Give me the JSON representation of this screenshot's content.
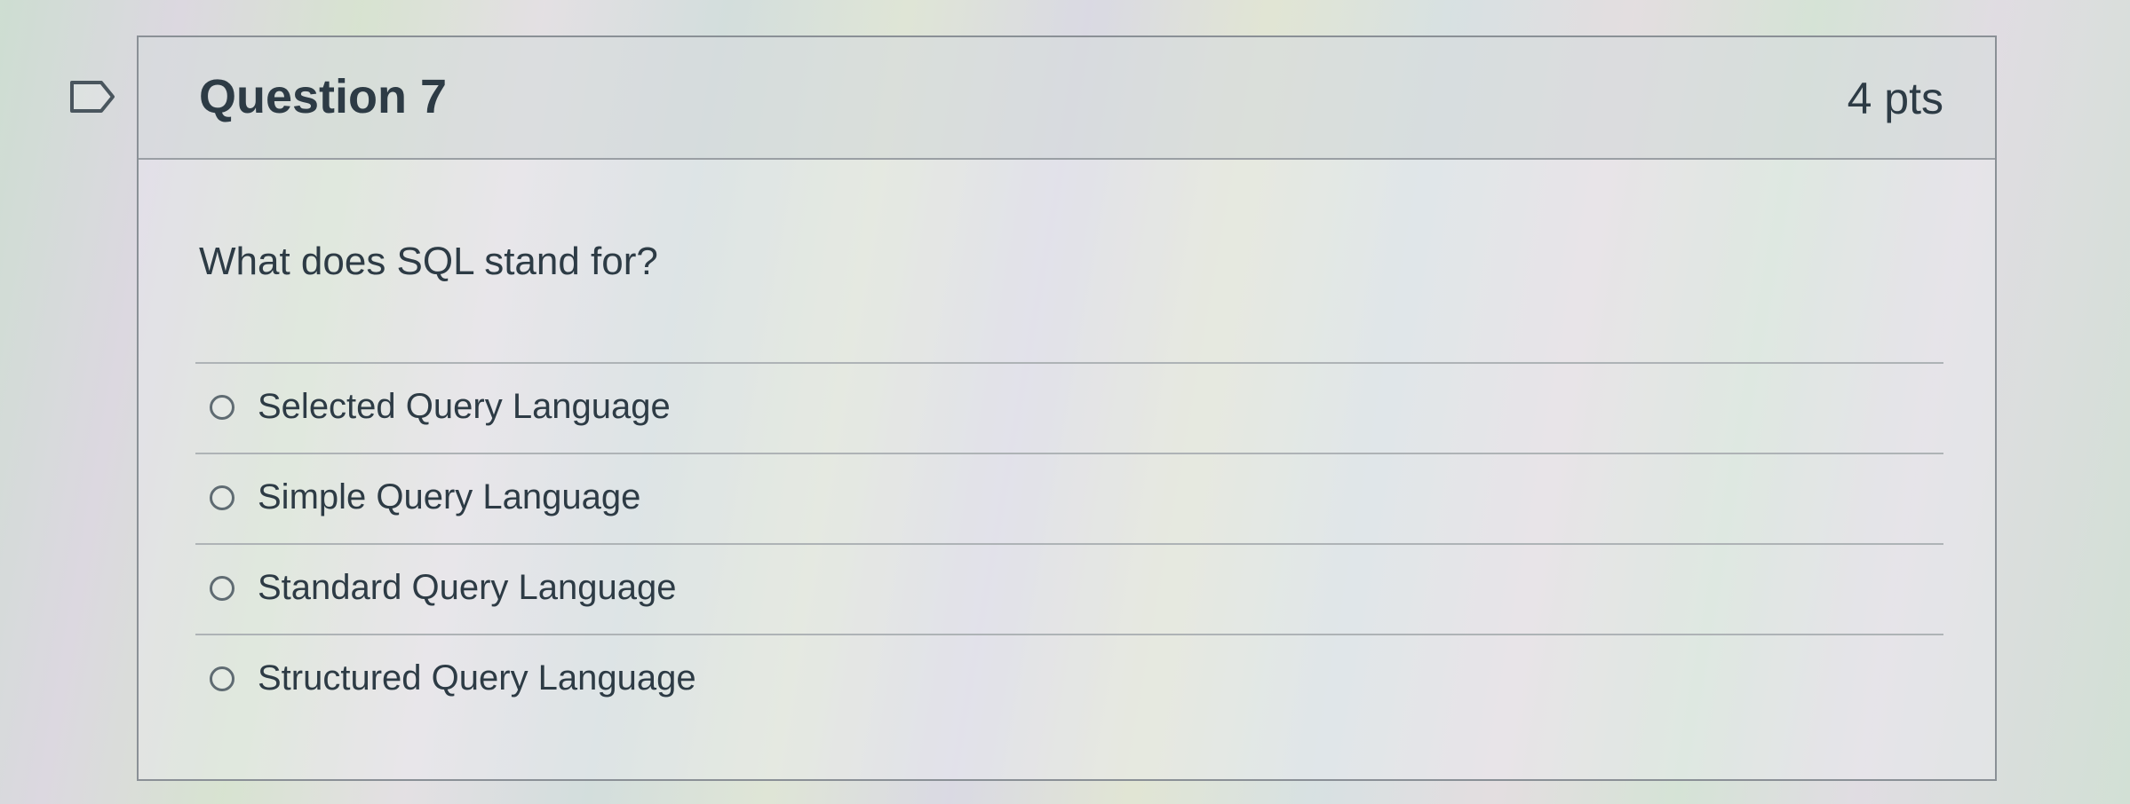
{
  "question": {
    "title": "Question 7",
    "points": "4 pts",
    "prompt": "What does SQL stand for?",
    "flag_icon": "bookmark-flag-icon"
  },
  "answers": [
    {
      "label": "Selected Query Language",
      "selected": false
    },
    {
      "label": "Simple Query Language",
      "selected": false
    },
    {
      "label": "Standard Query Language",
      "selected": false
    },
    {
      "label": "Structured Query Language",
      "selected": false
    }
  ],
  "colors": {
    "text": "#2d3b45",
    "border": "#8a9096",
    "radio": "#5f6b72"
  }
}
